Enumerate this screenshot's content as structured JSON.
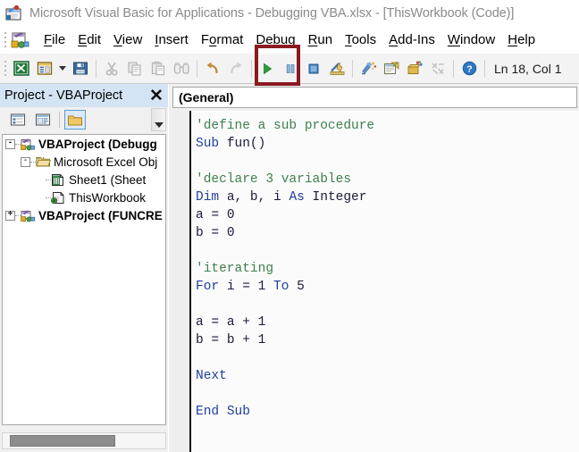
{
  "window": {
    "title": "Microsoft Visual Basic for Applications - Debugging VBA.xlsx - [ThisWorkbook (Code)]",
    "app_icon": "vba-app-icon"
  },
  "menubar": {
    "excel_icon": "excel-vba-icon",
    "items": [
      {
        "label": "File",
        "accel": "F"
      },
      {
        "label": "Edit",
        "accel": "E"
      },
      {
        "label": "View",
        "accel": "V"
      },
      {
        "label": "Insert",
        "accel": "I"
      },
      {
        "label": "Format",
        "accel": "o"
      },
      {
        "label": "Debug",
        "accel": "D"
      },
      {
        "label": "Run",
        "accel": "R"
      },
      {
        "label": "Tools",
        "accel": "T"
      },
      {
        "label": "Add-Ins",
        "accel": "A"
      },
      {
        "label": "Window",
        "accel": "W"
      },
      {
        "label": "Help",
        "accel": "H"
      }
    ]
  },
  "toolbar": {
    "buttons": [
      {
        "name": "view-excel-button",
        "icon": "excel-grid-icon",
        "tooltip": "View Microsoft Excel"
      },
      {
        "name": "insert-userform-button",
        "icon": "userform-icon",
        "tooltip": "Insert UserForm"
      },
      {
        "name": "insert-dropdown",
        "icon": "chevron-down-icon",
        "tooltip": "Insert"
      },
      {
        "name": "save-button",
        "icon": "floppy-disk-icon",
        "tooltip": "Save"
      },
      {
        "name": "cut-button",
        "icon": "scissors-icon",
        "tooltip": "Cut"
      },
      {
        "name": "copy-button",
        "icon": "copy-icon",
        "tooltip": "Copy"
      },
      {
        "name": "paste-button",
        "icon": "clipboard-icon",
        "tooltip": "Paste"
      },
      {
        "name": "find-button",
        "icon": "binoculars-icon",
        "tooltip": "Find"
      },
      {
        "name": "undo-button",
        "icon": "undo-arrow-icon",
        "tooltip": "Undo"
      },
      {
        "name": "redo-button",
        "icon": "redo-arrow-icon",
        "tooltip": "Redo"
      },
      {
        "name": "run-button",
        "icon": "play-triangle-icon",
        "tooltip": "Run Sub/UserForm"
      },
      {
        "name": "break-button",
        "icon": "pause-bars-icon",
        "tooltip": "Break"
      },
      {
        "name": "reset-button",
        "icon": "stop-square-icon",
        "tooltip": "Reset"
      },
      {
        "name": "design-mode-button",
        "icon": "ruler-pencil-icon",
        "tooltip": "Design Mode"
      },
      {
        "name": "project-explorer-button",
        "icon": "project-explorer-icon",
        "tooltip": "Project Explorer"
      },
      {
        "name": "properties-window-button",
        "icon": "properties-icon",
        "tooltip": "Properties Window"
      },
      {
        "name": "object-browser-button",
        "icon": "object-browser-icon",
        "tooltip": "Object Browser"
      },
      {
        "name": "toolbox-button",
        "icon": "toolbox-icon",
        "tooltip": "Toolbox"
      },
      {
        "name": "help-button",
        "icon": "help-question-icon",
        "tooltip": "Help"
      }
    ],
    "status": "Ln 18, Col 1",
    "highlight_color": "#8b1a21",
    "highlighted_button": "run-button"
  },
  "project_explorer": {
    "title": "Project - VBAProject",
    "close_icon": "close-x-icon",
    "toolbar": [
      {
        "name": "view-code-button",
        "icon": "view-code-icon"
      },
      {
        "name": "view-object-button",
        "icon": "view-object-icon"
      },
      {
        "name": "toggle-folders-button",
        "icon": "folder-icon",
        "active": true
      }
    ],
    "tree": [
      {
        "label": "VBAProject (Debugg",
        "icon": "vba-project-icon",
        "indent": 0,
        "expander": "-",
        "bold": true
      },
      {
        "label": "Microsoft Excel Obj",
        "icon": "folder-open-icon",
        "indent": 1,
        "expander": "-",
        "bold": false
      },
      {
        "label": "Sheet1 (Sheet",
        "icon": "worksheet-icon",
        "indent": 2,
        "expander": "",
        "bold": false
      },
      {
        "label": "ThisWorkbook",
        "icon": "workbook-icon",
        "indent": 2,
        "expander": "",
        "bold": false
      },
      {
        "label": "VBAProject (FUNCRE",
        "icon": "vba-project-icon",
        "indent": 0,
        "expander": "+",
        "bold": true
      }
    ],
    "scroll_down_icon": "scroll-down-arrow-icon"
  },
  "code_pane": {
    "header": "(General)",
    "lines": [
      {
        "text": "'define a sub procedure",
        "type": "comment"
      },
      {
        "text": "Sub fun()",
        "type": "code",
        "keywords": [
          "Sub"
        ]
      },
      {
        "text": "",
        "type": "blank"
      },
      {
        "text": "'declare 3 variables",
        "type": "comment"
      },
      {
        "text": "Dim a, b, i As Integer",
        "type": "code",
        "keywords": [
          "Dim",
          "As"
        ]
      },
      {
        "text": "a = 0",
        "type": "code",
        "keywords": []
      },
      {
        "text": "b = 0",
        "type": "code",
        "keywords": []
      },
      {
        "text": "",
        "type": "blank"
      },
      {
        "text": "'iterating",
        "type": "comment"
      },
      {
        "text": "For i = 1 To 5",
        "type": "code",
        "keywords": [
          "For",
          "To"
        ]
      },
      {
        "text": "",
        "type": "blank"
      },
      {
        "text": "a = a + 1",
        "type": "code",
        "keywords": []
      },
      {
        "text": "b = b + 1",
        "type": "code",
        "keywords": []
      },
      {
        "text": "",
        "type": "blank"
      },
      {
        "text": "Next",
        "type": "code",
        "keywords": [
          "Next"
        ]
      },
      {
        "text": "",
        "type": "blank"
      },
      {
        "text": "End Sub",
        "type": "code",
        "keywords": [
          "End",
          "Sub"
        ]
      }
    ],
    "comment_color": "#3f7f4f",
    "keyword_color": "#1f3f9f",
    "text_color": "#1b1b3a"
  }
}
